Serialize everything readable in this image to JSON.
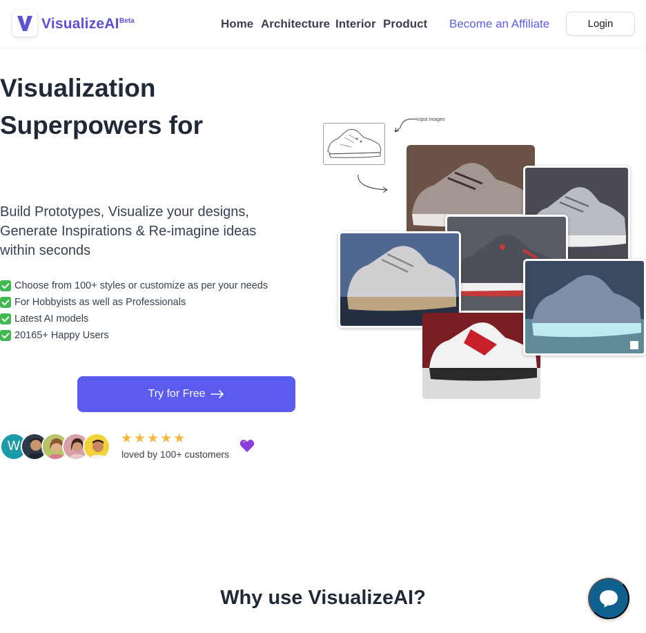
{
  "header": {
    "brand": "VisualizeAI",
    "badge": "Beta",
    "nav": [
      "Home",
      "Architecture",
      "Interior",
      "Product"
    ],
    "affiliate": "Become an Affiliate",
    "login": "Login"
  },
  "hero": {
    "title_line1": "Visualization",
    "title_line2": "Superpowers for",
    "subtitle": "Build Prototypes, Visualize your designs, Generate Inspirations & Re-imagine ideas within seconds",
    "features": [
      "Choose from 100+ styles or customize as per your needs",
      "For Hobbyists as well as Professionals",
      "Latest AI models",
      "20165+ Happy Users"
    ],
    "cta": "Try for Free",
    "avatar_initial": "W",
    "rating_stars": 5,
    "loved": "loved by 100+ customers"
  },
  "collage": {
    "input_label": "Input Images"
  },
  "section": {
    "title": "Why use VisualizeAI?"
  },
  "colors": {
    "brand": "#5b50d6",
    "cta": "#5b5bf0",
    "chat": "#0f5f8f",
    "star": "#f5b83d"
  },
  "icons": [
    "check-icon",
    "arrow-right-icon",
    "star-icon",
    "purple-heart-icon",
    "chat-icon"
  ]
}
